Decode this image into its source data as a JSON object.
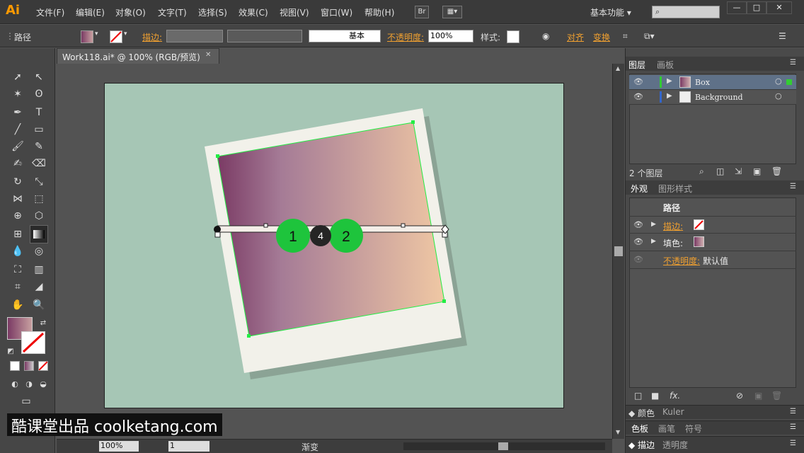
{
  "app": {
    "logo": "Ai"
  },
  "menu": [
    "文件(F)",
    "编辑(E)",
    "对象(O)",
    "文字(T)",
    "选择(S)",
    "效果(C)",
    "视图(V)",
    "窗口(W)",
    "帮助(H)"
  ],
  "bridge_label": "Br",
  "workspace": "基本功能",
  "window_controls": {
    "min": "—",
    "max": "□",
    "close": "✕"
  },
  "control_bar": {
    "object_type": "路径",
    "stroke_label": "描边:",
    "stroke_style": "基本",
    "opacity_label": "不透明度:",
    "opacity_value": "100%",
    "style_label": "样式:",
    "align_label": "对齐",
    "transform_label": "变换"
  },
  "document_tab": {
    "title": "Work118.ai* @ 100% (RGB/预览)",
    "close": "✕"
  },
  "gradient_annotator": {
    "stop1": "1",
    "stop2": "2",
    "midpoint": "4"
  },
  "status_bar": {
    "zoom": "100%",
    "page": "1",
    "tool": "渐变"
  },
  "layers_panel": {
    "tabs": [
      "图层",
      "画板"
    ],
    "layers": [
      {
        "name": "Box",
        "color": "#33cc33"
      },
      {
        "name": "Background",
        "color": "#3366cc"
      }
    ],
    "count": "2 个图层"
  },
  "appearance_panel": {
    "tabs": [
      "外观",
      "图形样式"
    ],
    "title": "路径",
    "stroke_label": "描边:",
    "fill_label": "填色:",
    "opacity_label": "不透明度:",
    "opacity_value": "默认值",
    "fx": "fx."
  },
  "collapsed_panels": [
    [
      "颜色",
      "Kuler"
    ],
    [
      "色板",
      "画笔",
      "符号"
    ],
    [
      "描边",
      "透明度"
    ]
  ],
  "watermark": "酷课堂出品 coolketang.com"
}
